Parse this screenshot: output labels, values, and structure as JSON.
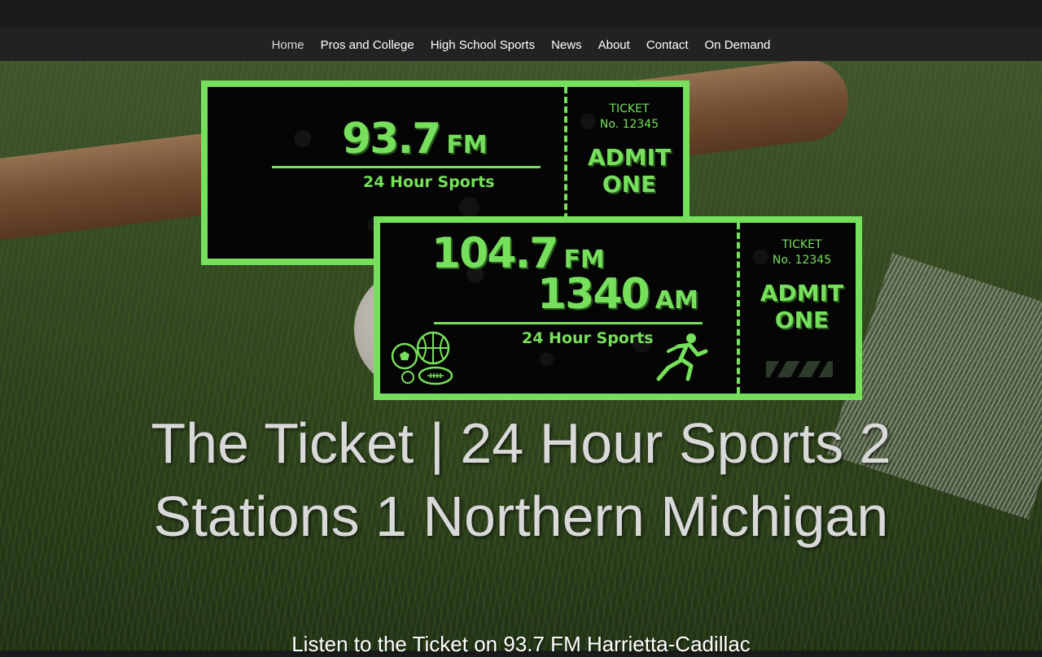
{
  "nav": {
    "items": [
      {
        "label": "Home"
      },
      {
        "label": "Pros and College"
      },
      {
        "label": "High School Sports"
      },
      {
        "label": "News"
      },
      {
        "label": "About"
      },
      {
        "label": "Contact"
      },
      {
        "label": "On Demand"
      }
    ]
  },
  "ticket1": {
    "freq": "93.7",
    "unit": "FM",
    "tagline": "24 Hour Sports",
    "stub_label": "TICKET",
    "stub_number": "No. 12345",
    "admit_line1": "ADMIT",
    "admit_line2": "ONE"
  },
  "ticket2": {
    "freq1": "104.7",
    "unit1": "FM",
    "freq2": "1340",
    "unit2": "AM",
    "tagline": "24 Hour Sports",
    "stub_label": "TICKET",
    "stub_number": "No. 12345",
    "admit_line1": "ADMIT",
    "admit_line2": "ONE",
    "icons": [
      "sports-balls-icon",
      "runner-icon"
    ]
  },
  "hero": {
    "headline": "The Ticket | 24 Hour Sports 2 Stations 1 Northern Michigan",
    "subline": "Listen to the Ticket on 93.7 FM Harrietta-Cadillac"
  },
  "colors": {
    "accent": "#76e05c",
    "nav_bg": "#222222",
    "topbar_bg": "#1b1b1b"
  }
}
